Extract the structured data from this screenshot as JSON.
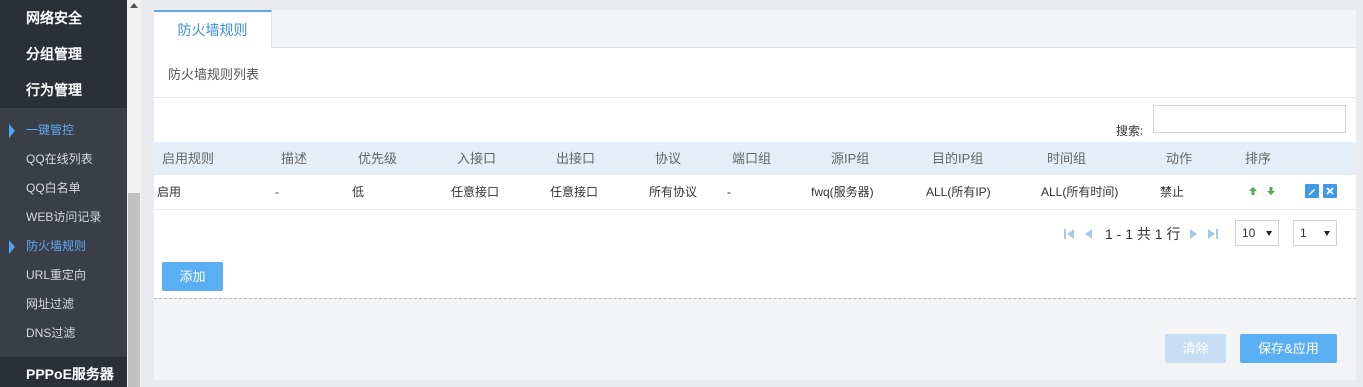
{
  "sidebar": {
    "categories": [
      "网络安全",
      "分组管理",
      "行为管理",
      "PPPoE服务器"
    ],
    "items": [
      {
        "label": "一键管控",
        "active": true
      },
      {
        "label": "QQ在线列表",
        "active": false
      },
      {
        "label": "QQ白名单",
        "active": false
      },
      {
        "label": "WEB访问记录",
        "active": false
      },
      {
        "label": "防火墙规则",
        "active": true
      },
      {
        "label": "URL重定向",
        "active": false
      },
      {
        "label": "网址过滤",
        "active": false
      },
      {
        "label": "DNS过滤",
        "active": false
      }
    ]
  },
  "tab": {
    "label": "防火墙规则"
  },
  "section": {
    "title": "防火墙规则列表"
  },
  "search": {
    "label": "搜索:",
    "value": ""
  },
  "table": {
    "headers": [
      "启用规则",
      "描述",
      "优先级",
      "入接口",
      "出接口",
      "协议",
      "端口组",
      "源IP组",
      "目的IP组",
      "时间组",
      "动作",
      "排序"
    ],
    "rows": [
      [
        "启用",
        "-",
        "低",
        "任意接口",
        "任意接口",
        "所有协议",
        "-",
        "fwq(服务器)",
        "ALL(所有IP)",
        "ALL(所有时间)",
        "禁止"
      ]
    ]
  },
  "pager": {
    "summary": "1 - 1 共 1 行",
    "page_size": "10",
    "page": "1"
  },
  "buttons": {
    "add": "添加",
    "clear": "清除",
    "save": "保存&应用"
  },
  "colors": {
    "accent": "#5aaef2",
    "sidebar_bg": "#2b2f36",
    "table_header_bg": "#e3eef9"
  }
}
